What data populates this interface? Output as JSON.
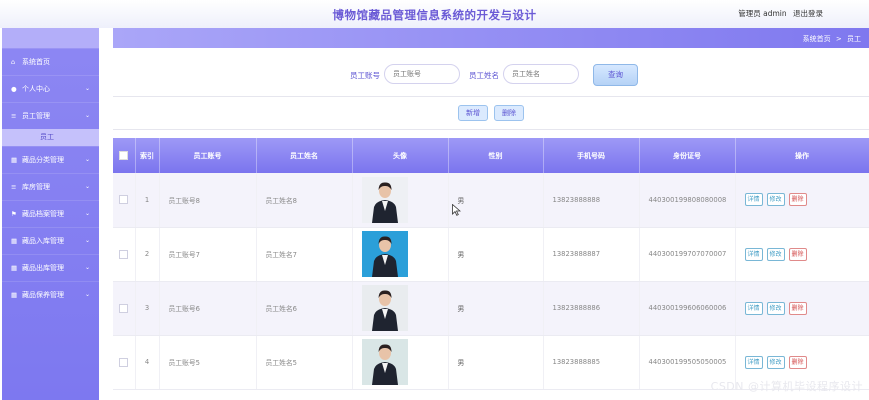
{
  "header": {
    "title": "博物馆藏品管理信息系统的开发与设计",
    "user_role": "管理员 admin",
    "logout": "退出登录"
  },
  "sidebar": {
    "items": [
      {
        "label": "系统首页",
        "icon": "home-icon",
        "glyph": "⌂",
        "has_chevron": false
      },
      {
        "label": "个人中心",
        "icon": "user-icon",
        "glyph": "●",
        "has_chevron": true
      },
      {
        "label": "员工管理",
        "icon": "list-icon",
        "glyph": "≡",
        "has_chevron": true
      },
      {
        "label": "藏品分类管理",
        "icon": "grid-icon",
        "glyph": "▦",
        "has_chevron": true
      },
      {
        "label": "库房管理",
        "icon": "list-icon",
        "glyph": "≡",
        "has_chevron": true
      },
      {
        "label": "藏品档案管理",
        "icon": "flag-icon",
        "glyph": "⚑",
        "has_chevron": true
      },
      {
        "label": "藏品入库管理",
        "icon": "grid-icon",
        "glyph": "▦",
        "has_chevron": true
      },
      {
        "label": "藏品出库管理",
        "icon": "grid-icon",
        "glyph": "▦",
        "has_chevron": true
      },
      {
        "label": "藏品保养管理",
        "icon": "grid-icon",
        "glyph": "▦",
        "has_chevron": true
      }
    ],
    "active_sub": "员工"
  },
  "breadcrumb": {
    "home": "系统首页",
    "separator": ">",
    "current": "员工"
  },
  "search": {
    "account_label": "员工账号",
    "account_placeholder": "员工账号",
    "name_label": "员工姓名",
    "name_placeholder": "员工姓名",
    "button": "查询"
  },
  "actions": {
    "add": "新增",
    "delete": "删除"
  },
  "table": {
    "headers": [
      "索引",
      "员工账号",
      "员工姓名",
      "头像",
      "性别",
      "手机号码",
      "身份证号",
      "操作"
    ],
    "rows": [
      {
        "index": "1",
        "account": "员工账号8",
        "name": "员工姓名8",
        "gender": "男",
        "phone": "13823888888",
        "id_card": "440300199808080008"
      },
      {
        "index": "2",
        "account": "员工账号7",
        "name": "员工姓名7",
        "gender": "男",
        "phone": "13823888887",
        "id_card": "440300199707070007"
      },
      {
        "index": "3",
        "account": "员工账号6",
        "name": "员工姓名6",
        "gender": "男",
        "phone": "13823888886",
        "id_card": "440300199606060006"
      },
      {
        "index": "4",
        "account": "员工账号5",
        "name": "员工姓名5",
        "gender": "男",
        "phone": "13823888885",
        "id_card": "440300199505050005"
      }
    ],
    "ops": {
      "detail": "详情",
      "edit": "修改",
      "delete": "删除"
    }
  },
  "watermark": "CSDN @计算机毕设程序设计",
  "colors": {
    "primary": "#7f78ef",
    "sidebar": "#8d87f3",
    "title": "#6b5bd6",
    "delete": "#d24b4b"
  }
}
